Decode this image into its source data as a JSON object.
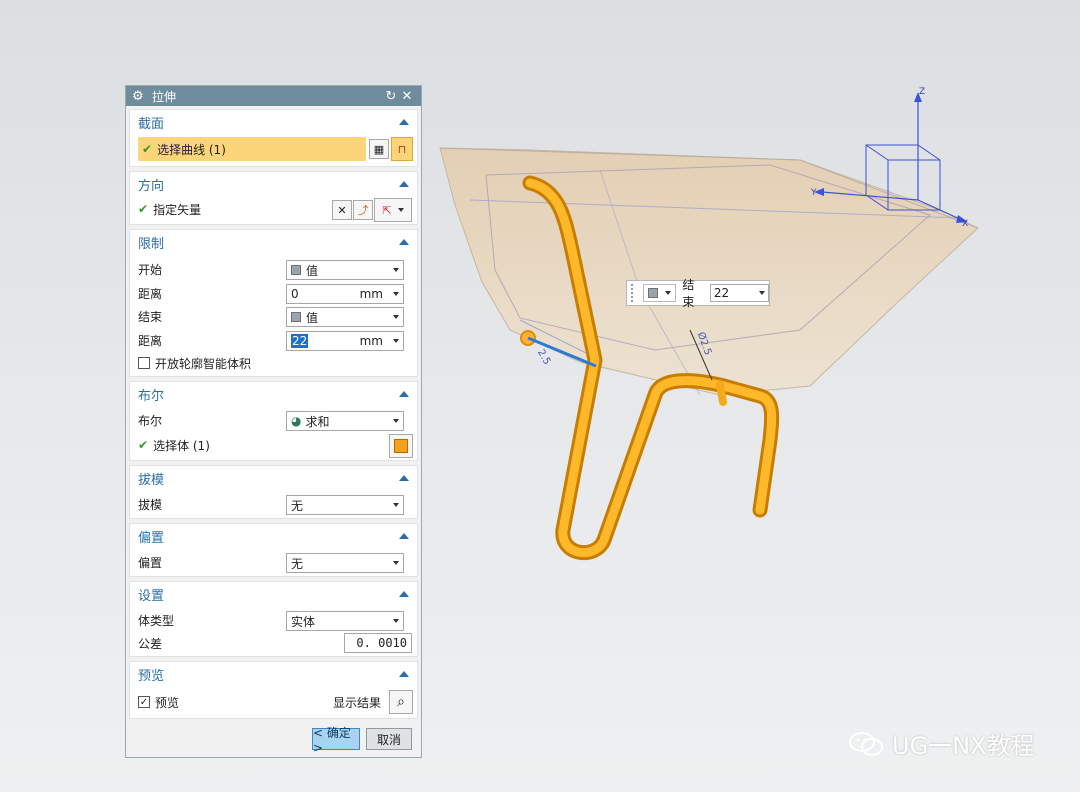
{
  "dialog": {
    "title": "拉伸",
    "reset_icon": "↻",
    "close_icon": "✕",
    "gear_icon": "⚙",
    "sections": {
      "section": {
        "title": "截面",
        "select_curve": "选择曲线 (1)"
      },
      "direction": {
        "title": "方向",
        "specify_vector": "指定矢量"
      },
      "limits": {
        "title": "限制",
        "start_label": "开始",
        "start_value": "值",
        "distance1_label": "距离",
        "distance1_value": "0",
        "distance1_unit": "mm",
        "end_label": "结束",
        "end_value": "值",
        "distance2_label": "距离",
        "distance2_value": "22",
        "distance2_unit": "mm",
        "open_profile": "开放轮廓智能体积"
      },
      "boolean": {
        "title": "布尔",
        "boolean_label": "布尔",
        "boolean_value": "求和",
        "select_body": "选择体 (1)"
      },
      "draft": {
        "title": "拔模",
        "draft_label": "拔模",
        "draft_value": "无"
      },
      "offset": {
        "title": "偏置",
        "offset_label": "偏置",
        "offset_value": "无"
      },
      "settings": {
        "title": "设置",
        "body_type_label": "体类型",
        "body_type_value": "实体",
        "tolerance_label": "公差",
        "tolerance_value": "0. 0010"
      },
      "preview": {
        "title": "预览",
        "preview_label": "预览",
        "show_result": "显示结果"
      }
    },
    "ok_label": "< 确定 >",
    "cancel_label": "取消"
  },
  "float_tag": {
    "end_label": "结束",
    "end_value": "22"
  },
  "viewport_labels": {
    "dim_diameter": "Ø2.5",
    "dim_small": "2.5",
    "axis_z": "Z",
    "axis_x": "X",
    "axis_y": "Y"
  },
  "watermark": {
    "text": "UG一NX教程"
  },
  "colors": {
    "tube": "#f3a91a",
    "tray": "#e9c99b",
    "title_bar": "#6f8c9d",
    "selection": "#fcd57a"
  }
}
